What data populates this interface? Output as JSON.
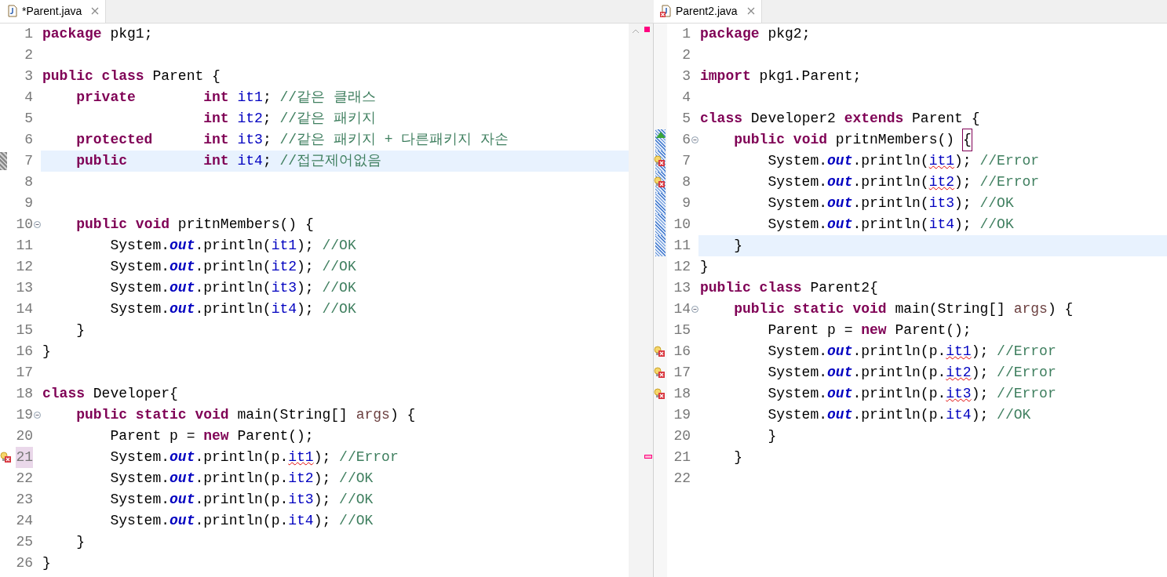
{
  "editors": [
    {
      "tab": {
        "title": "*Parent.java",
        "error": false
      },
      "lines": [
        {
          "number": "1",
          "overview_mark": true,
          "tokens": [
            {
              "kind": "keyword",
              "text": "package"
            },
            {
              "kind": "text",
              "text": " pkg1;"
            }
          ]
        },
        {
          "number": "2"
        },
        {
          "number": "3",
          "tokens": [
            {
              "kind": "keyword",
              "text": "public"
            },
            {
              "kind": "keyword",
              "text": " class"
            },
            {
              "kind": "text",
              "text": " Parent {"
            }
          ]
        },
        {
          "number": "4",
          "tokens": [
            {
              "kind": "keyword",
              "text": "    private"
            },
            {
              "kind": "keyword",
              "text": "        int"
            },
            {
              "kind": "field",
              "text": " it1"
            },
            {
              "kind": "text",
              "text": ";"
            },
            {
              "kind": "comment",
              "text": " //같은 클래스"
            }
          ]
        },
        {
          "number": "5",
          "tokens": [
            {
              "kind": "keyword",
              "text": "                   int"
            },
            {
              "kind": "field",
              "text": " it2"
            },
            {
              "kind": "text",
              "text": ";"
            },
            {
              "kind": "comment",
              "text": " //같은 패키지"
            }
          ]
        },
        {
          "number": "6",
          "tokens": [
            {
              "kind": "keyword",
              "text": "    protected"
            },
            {
              "kind": "keyword",
              "text": "      int"
            },
            {
              "kind": "field",
              "text": " it3"
            },
            {
              "kind": "text",
              "text": ";"
            },
            {
              "kind": "comment",
              "text": " //같은 패키지 + 다른패키지 자손"
            }
          ]
        },
        {
          "number": "7",
          "current": true,
          "change_mark": true,
          "tokens": [
            {
              "kind": "keyword",
              "text": "    public"
            },
            {
              "kind": "keyword",
              "text": "         int"
            },
            {
              "kind": "field",
              "text": " it4"
            },
            {
              "kind": "text",
              "text": ";"
            },
            {
              "kind": "comment",
              "text": " //접근제어없음"
            }
          ]
        },
        {
          "number": "8"
        },
        {
          "number": "9"
        },
        {
          "number": "10",
          "fold": true,
          "tokens": [
            {
              "kind": "keyword",
              "text": "    public"
            },
            {
              "kind": "keyword",
              "text": " void"
            },
            {
              "kind": "text",
              "text": " pritnMembers() {"
            }
          ]
        },
        {
          "number": "11",
          "tokens": [
            {
              "kind": "text",
              "text": "        System."
            },
            {
              "kind": "static",
              "text": "out"
            },
            {
              "kind": "text",
              "text": ".println("
            },
            {
              "kind": "field",
              "text": "it1"
            },
            {
              "kind": "text",
              "text": ");"
            },
            {
              "kind": "comment",
              "text": " //OK"
            }
          ]
        },
        {
          "number": "12",
          "tokens": [
            {
              "kind": "text",
              "text": "        System."
            },
            {
              "kind": "static",
              "text": "out"
            },
            {
              "kind": "text",
              "text": ".println("
            },
            {
              "kind": "field",
              "text": "it2"
            },
            {
              "kind": "text",
              "text": ");"
            },
            {
              "kind": "comment",
              "text": " //OK"
            }
          ]
        },
        {
          "number": "13",
          "tokens": [
            {
              "kind": "text",
              "text": "        System."
            },
            {
              "kind": "static",
              "text": "out"
            },
            {
              "kind": "text",
              "text": ".println("
            },
            {
              "kind": "field",
              "text": "it3"
            },
            {
              "kind": "text",
              "text": ");"
            },
            {
              "kind": "comment",
              "text": " //OK"
            }
          ]
        },
        {
          "number": "14",
          "tokens": [
            {
              "kind": "text",
              "text": "        System."
            },
            {
              "kind": "static",
              "text": "out"
            },
            {
              "kind": "text",
              "text": ".println("
            },
            {
              "kind": "field",
              "text": "it4"
            },
            {
              "kind": "text",
              "text": ");"
            },
            {
              "kind": "comment",
              "text": " //OK"
            }
          ]
        },
        {
          "number": "15",
          "tokens": [
            {
              "kind": "text",
              "text": "    }"
            }
          ]
        },
        {
          "number": "16",
          "tokens": [
            {
              "kind": "text",
              "text": "}"
            }
          ]
        },
        {
          "number": "17"
        },
        {
          "number": "18",
          "tokens": [
            {
              "kind": "keyword",
              "text": "class"
            },
            {
              "kind": "text",
              "text": " Developer{"
            }
          ]
        },
        {
          "number": "19",
          "fold": true,
          "tokens": [
            {
              "kind": "keyword",
              "text": "    public"
            },
            {
              "kind": "keyword",
              "text": " static"
            },
            {
              "kind": "keyword",
              "text": " void"
            },
            {
              "kind": "text",
              "text": " main(String[]"
            },
            {
              "kind": "param",
              "text": " args"
            },
            {
              "kind": "text",
              "text": ") {"
            }
          ]
        },
        {
          "number": "20",
          "tokens": [
            {
              "kind": "text",
              "text": "        Parent p = "
            },
            {
              "kind": "keyword",
              "text": "new"
            },
            {
              "kind": "text",
              "text": " Parent();"
            }
          ]
        },
        {
          "number": "21",
          "error": true,
          "number_highlight": true,
          "overview_mark": true,
          "tokens": [
            {
              "kind": "text",
              "text": "        System."
            },
            {
              "kind": "static",
              "text": "out"
            },
            {
              "kind": "text",
              "text": ".println(p."
            },
            {
              "kind": "error_field",
              "text": "it1"
            },
            {
              "kind": "text",
              "text": ");"
            },
            {
              "kind": "comment",
              "text": " //Error"
            }
          ]
        },
        {
          "number": "22",
          "tokens": [
            {
              "kind": "text",
              "text": "        System."
            },
            {
              "kind": "static",
              "text": "out"
            },
            {
              "kind": "text",
              "text": ".println(p."
            },
            {
              "kind": "field",
              "text": "it2"
            },
            {
              "kind": "text",
              "text": ");"
            },
            {
              "kind": "comment",
              "text": " //OK"
            }
          ]
        },
        {
          "number": "23",
          "tokens": [
            {
              "kind": "text",
              "text": "        System."
            },
            {
              "kind": "static",
              "text": "out"
            },
            {
              "kind": "text",
              "text": ".println(p."
            },
            {
              "kind": "field",
              "text": "it3"
            },
            {
              "kind": "text",
              "text": ");"
            },
            {
              "kind": "comment",
              "text": " //OK"
            }
          ]
        },
        {
          "number": "24",
          "tokens": [
            {
              "kind": "text",
              "text": "        System."
            },
            {
              "kind": "static",
              "text": "out"
            },
            {
              "kind": "text",
              "text": ".println(p."
            },
            {
              "kind": "field",
              "text": "it4"
            },
            {
              "kind": "text",
              "text": ");"
            },
            {
              "kind": "comment",
              "text": " //OK"
            }
          ]
        },
        {
          "number": "25",
          "tokens": [
            {
              "kind": "text",
              "text": "    }"
            }
          ]
        },
        {
          "number": "26",
          "tokens": [
            {
              "kind": "text",
              "text": "}"
            }
          ]
        }
      ]
    },
    {
      "tab": {
        "title": "Parent2.java",
        "error": true
      },
      "lines": [
        {
          "number": "1",
          "tokens": [
            {
              "kind": "keyword",
              "text": "package"
            },
            {
              "kind": "text",
              "text": " pkg2;"
            }
          ]
        },
        {
          "number": "2"
        },
        {
          "number": "3",
          "tokens": [
            {
              "kind": "keyword",
              "text": "import"
            },
            {
              "kind": "text",
              "text": " pkg1.Parent;"
            }
          ]
        },
        {
          "number": "4"
        },
        {
          "number": "5",
          "tokens": [
            {
              "kind": "keyword",
              "text": "class"
            },
            {
              "kind": "text",
              "text": " Developer2 "
            },
            {
              "kind": "keyword",
              "text": "extends"
            },
            {
              "kind": "text",
              "text": " Parent {"
            }
          ]
        },
        {
          "number": "6",
          "fold": true,
          "override": true,
          "range": true,
          "tokens": [
            {
              "kind": "keyword",
              "text": "    public"
            },
            {
              "kind": "keyword",
              "text": " void"
            },
            {
              "kind": "text",
              "text": " pritnMembers() "
            },
            {
              "kind": "bracket",
              "text": "{"
            }
          ]
        },
        {
          "number": "7",
          "error": true,
          "range": true,
          "tokens": [
            {
              "kind": "text",
              "text": "        System."
            },
            {
              "kind": "static",
              "text": "out"
            },
            {
              "kind": "text",
              "text": ".println("
            },
            {
              "kind": "error_field",
              "text": "it1"
            },
            {
              "kind": "text",
              "text": ");"
            },
            {
              "kind": "comment",
              "text": " //Error"
            }
          ]
        },
        {
          "number": "8",
          "error": true,
          "range": true,
          "tokens": [
            {
              "kind": "text",
              "text": "        System."
            },
            {
              "kind": "static",
              "text": "out"
            },
            {
              "kind": "text",
              "text": ".println("
            },
            {
              "kind": "error_field",
              "text": "it2"
            },
            {
              "kind": "text",
              "text": ");"
            },
            {
              "kind": "comment",
              "text": " //Error"
            }
          ]
        },
        {
          "number": "9",
          "range": true,
          "tokens": [
            {
              "kind": "text",
              "text": "        System."
            },
            {
              "kind": "static",
              "text": "out"
            },
            {
              "kind": "text",
              "text": ".println("
            },
            {
              "kind": "field",
              "text": "it3"
            },
            {
              "kind": "text",
              "text": ");"
            },
            {
              "kind": "comment",
              "text": " //OK"
            }
          ]
        },
        {
          "number": "10",
          "range": true,
          "tokens": [
            {
              "kind": "text",
              "text": "        System."
            },
            {
              "kind": "static",
              "text": "out"
            },
            {
              "kind": "text",
              "text": ".println("
            },
            {
              "kind": "field",
              "text": "it4"
            },
            {
              "kind": "text",
              "text": ");"
            },
            {
              "kind": "comment",
              "text": " //OK"
            }
          ]
        },
        {
          "number": "11",
          "current": true,
          "range": true,
          "tokens": [
            {
              "kind": "text",
              "text": "    }"
            }
          ]
        },
        {
          "number": "12",
          "tokens": [
            {
              "kind": "text",
              "text": "}"
            }
          ]
        },
        {
          "number": "13",
          "tokens": [
            {
              "kind": "keyword",
              "text": "public"
            },
            {
              "kind": "keyword",
              "text": " class"
            },
            {
              "kind": "text",
              "text": " Parent2{"
            }
          ]
        },
        {
          "number": "14",
          "fold": true,
          "tokens": [
            {
              "kind": "keyword",
              "text": "    public"
            },
            {
              "kind": "keyword",
              "text": " static"
            },
            {
              "kind": "keyword",
              "text": " void"
            },
            {
              "kind": "text",
              "text": " main(String[]"
            },
            {
              "kind": "param",
              "text": " args"
            },
            {
              "kind": "text",
              "text": ") {"
            }
          ]
        },
        {
          "number": "15",
          "tokens": [
            {
              "kind": "text",
              "text": "        Parent p = "
            },
            {
              "kind": "keyword",
              "text": "new"
            },
            {
              "kind": "text",
              "text": " Parent();"
            }
          ]
        },
        {
          "number": "16",
          "error": true,
          "tokens": [
            {
              "kind": "text",
              "text": "        System."
            },
            {
              "kind": "static",
              "text": "out"
            },
            {
              "kind": "text",
              "text": ".println(p."
            },
            {
              "kind": "error_field",
              "text": "it1"
            },
            {
              "kind": "text",
              "text": ");"
            },
            {
              "kind": "comment",
              "text": " //Error"
            }
          ]
        },
        {
          "number": "17",
          "error": true,
          "tokens": [
            {
              "kind": "text",
              "text": "        System."
            },
            {
              "kind": "static",
              "text": "out"
            },
            {
              "kind": "text",
              "text": ".println(p."
            },
            {
              "kind": "error_field",
              "text": "it2"
            },
            {
              "kind": "text",
              "text": ");"
            },
            {
              "kind": "comment",
              "text": " //Error"
            }
          ]
        },
        {
          "number": "18",
          "error": true,
          "tokens": [
            {
              "kind": "text",
              "text": "        System."
            },
            {
              "kind": "static",
              "text": "out"
            },
            {
              "kind": "text",
              "text": ".println(p."
            },
            {
              "kind": "error_field",
              "text": "it3"
            },
            {
              "kind": "text",
              "text": ");"
            },
            {
              "kind": "comment",
              "text": " //Error"
            }
          ]
        },
        {
          "number": "19",
          "tokens": [
            {
              "kind": "text",
              "text": "        System."
            },
            {
              "kind": "static",
              "text": "out"
            },
            {
              "kind": "text",
              "text": ".println(p."
            },
            {
              "kind": "field",
              "text": "it4"
            },
            {
              "kind": "text",
              "text": ");"
            },
            {
              "kind": "comment",
              "text": " //OK"
            }
          ]
        },
        {
          "number": "20",
          "tokens": [
            {
              "kind": "text",
              "text": "        }"
            }
          ]
        },
        {
          "number": "21",
          "tokens": [
            {
              "kind": "text",
              "text": "    }"
            }
          ]
        },
        {
          "number": "22"
        }
      ]
    }
  ]
}
